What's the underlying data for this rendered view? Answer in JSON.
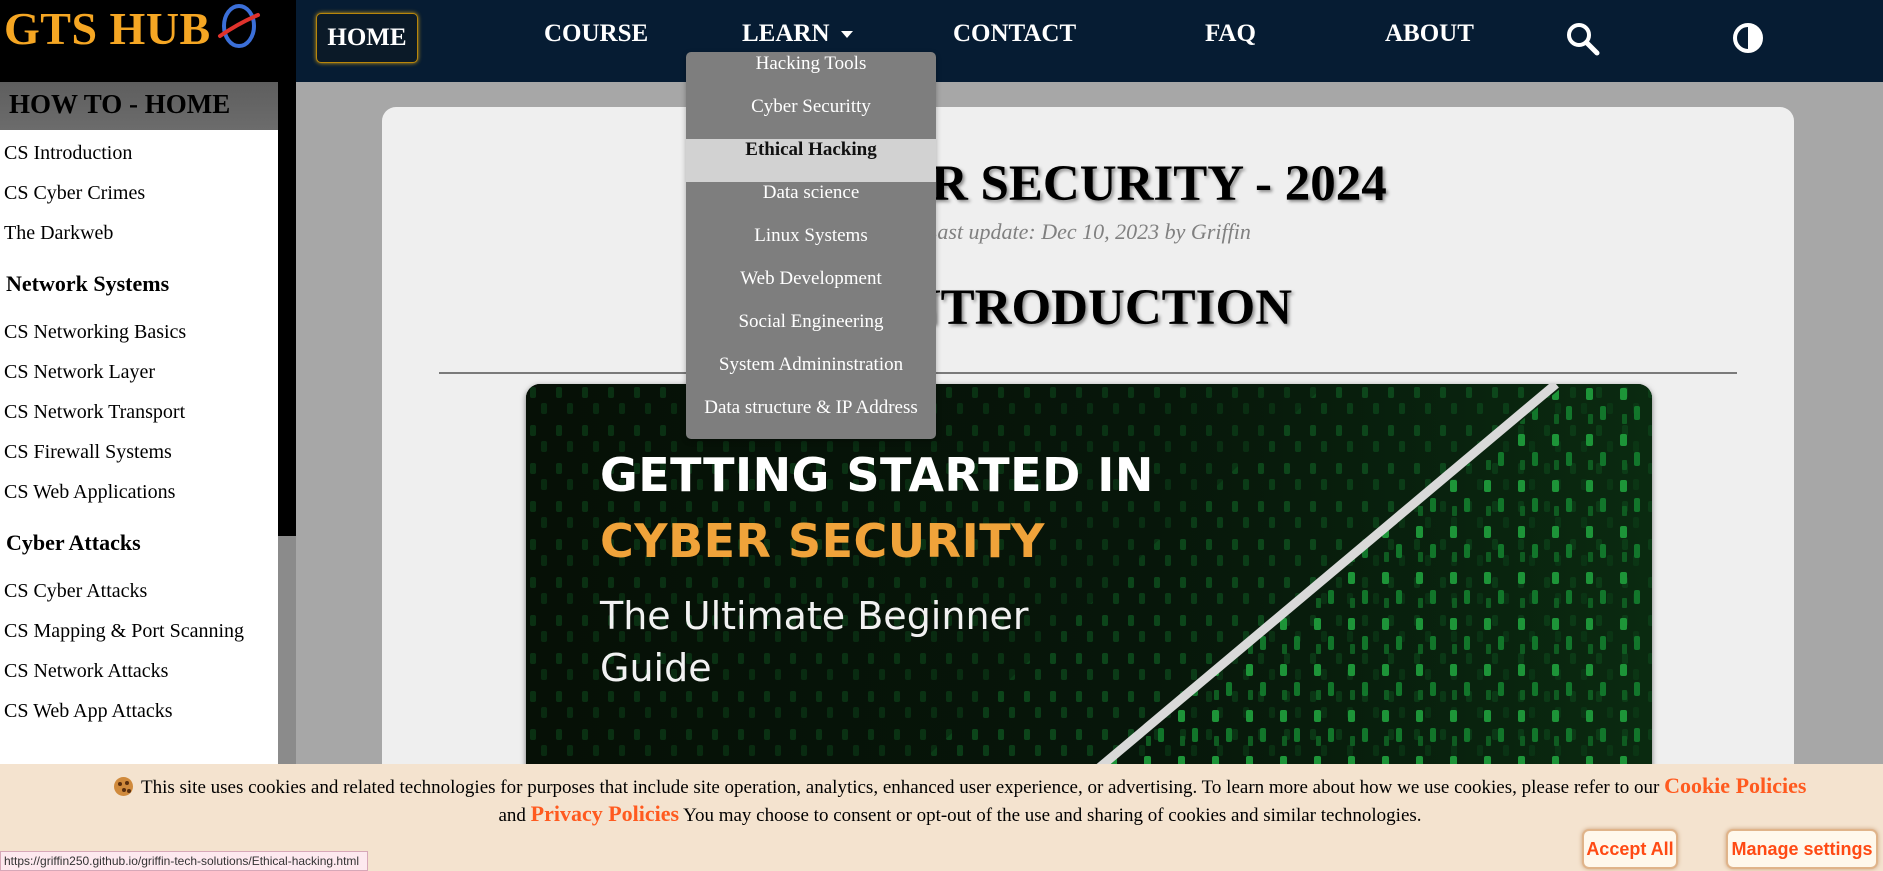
{
  "brand": {
    "logo_text": "GTS HUB",
    "accent_color": "#f5a623"
  },
  "nav": {
    "home": "HOME",
    "course": "COURSE",
    "learn": "LEARN",
    "contact": "CONTACT",
    "faq": "FAQ",
    "about": "ABOUT",
    "search_icon": "search-icon",
    "theme_icon": "contrast-icon"
  },
  "learn_menu": {
    "items": [
      "Hacking Tools",
      "Cyber Securitty",
      "Ethical Hacking",
      "Data science",
      "Linux Systems",
      "Web Development",
      "Social Engineering",
      "System Admininstration",
      "Data structure & IP Address"
    ],
    "active": "Ethical Hacking"
  },
  "sidebar": {
    "header": "HOW TO - HOME",
    "intro_links": [
      "CS Introduction",
      "CS Cyber Crimes",
      "The Darkweb"
    ],
    "groups": [
      {
        "title": "Network Systems",
        "links": [
          "CS Networking Basics",
          "CS Network Layer",
          "CS Network Transport",
          "CS Firewall Systems",
          "CS Web Applications"
        ]
      },
      {
        "title": "Cyber Attacks",
        "links": [
          "CS Cyber Attacks",
          "CS Mapping & Port Scanning",
          "CS Network Attacks",
          "CS Web App Attacks"
        ]
      }
    ]
  },
  "article": {
    "title": "CYBER SECURITY - 2024",
    "meta": "Last update: Dec 10, 2023 by Griffin",
    "heading": "INTRODUCTION"
  },
  "hero": {
    "line1": "GETTING STARTED IN",
    "line2": "CYBER SECURITY",
    "line3": "The Ultimate Beginner Guide",
    "highlight_color": "#f0a33a"
  },
  "cookies": {
    "text_before": "This site uses cookies and related technologies for purposes that include site operation, analytics, enhanced user experience, or advertising. To learn more about how we use cookies, please refer to our",
    "cookie_link": "Cookie Policies",
    "and": "and",
    "privacy_link": "Privacy Policies",
    "text_after": "You may choose to consent or opt-out of the use and sharing of cookies and similar technologies.",
    "accept": "Accept All",
    "manage": "Manage settings",
    "link_color": "#ff5a1f"
  },
  "status_bar": {
    "url": "https://griffin250.github.io/griffin-tech-solutions/Ethical-hacking.html"
  }
}
